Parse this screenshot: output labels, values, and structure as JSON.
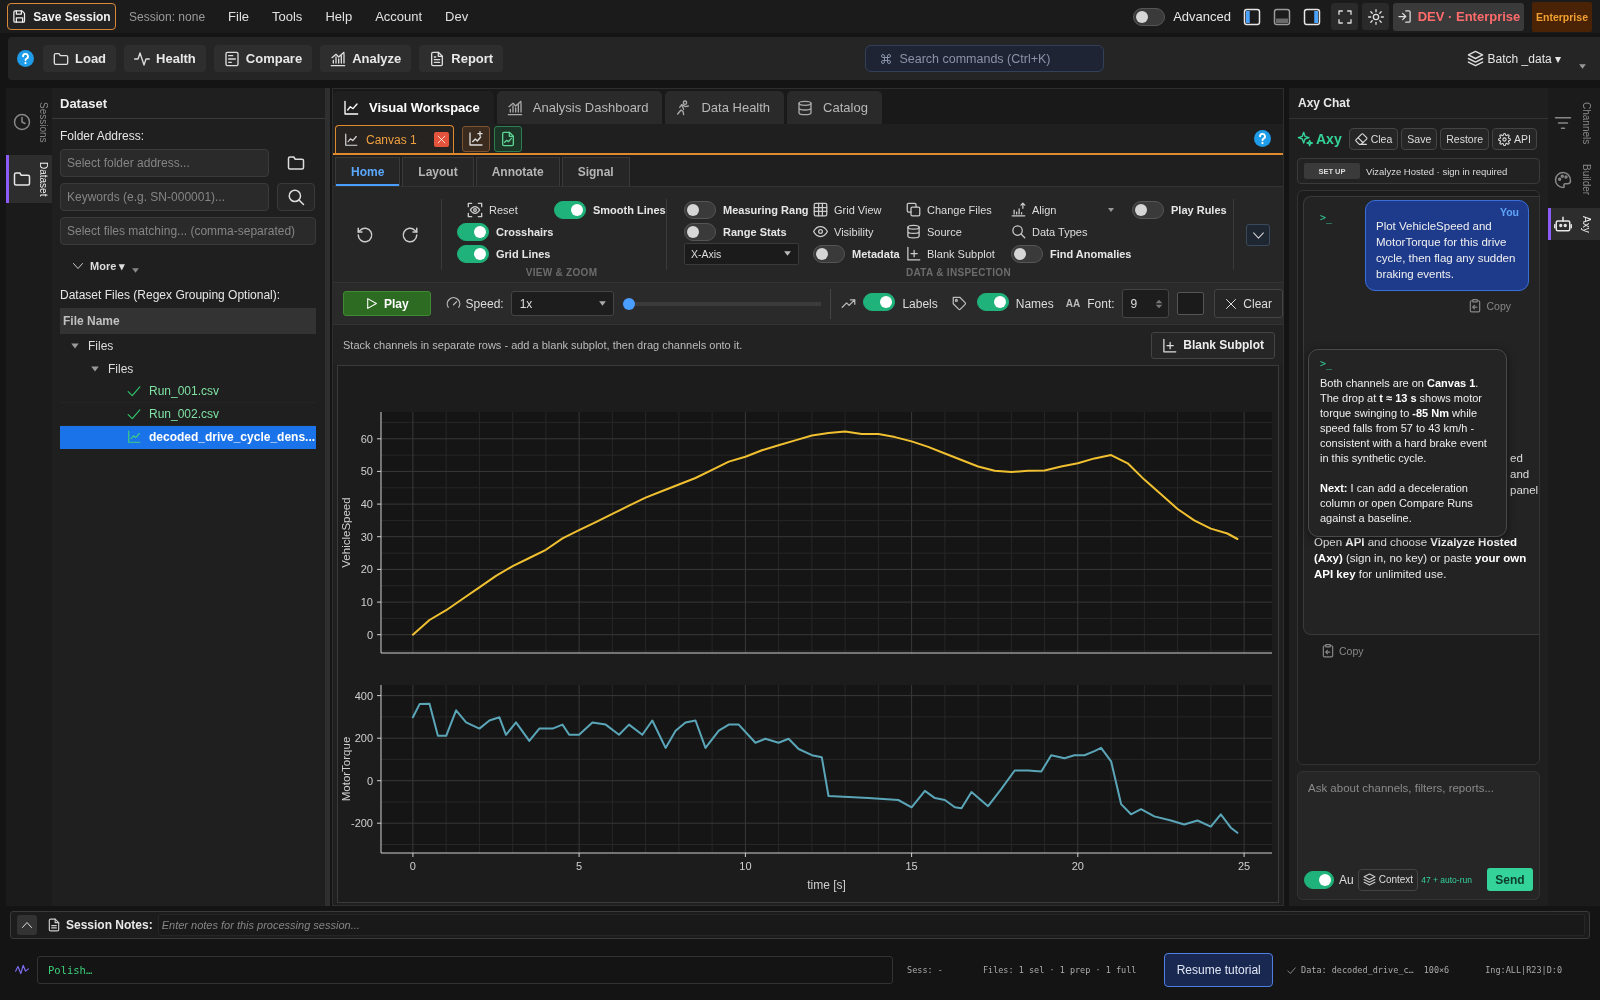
{
  "topbar": {
    "save_button": "Save Session",
    "session": "Session: none",
    "menu": [
      "File",
      "Tools",
      "Help",
      "Account",
      "Dev"
    ],
    "advanced": {
      "label": "Advanced",
      "on": false
    },
    "panel_toggles": [
      {
        "on": true
      },
      {
        "on": false
      },
      {
        "on": true
      }
    ],
    "env_button": "DEV · Enterprise",
    "plan_badge": "Enterprise"
  },
  "toolbar": {
    "buttons": [
      "Load",
      "Health",
      "Compare",
      "Analyze",
      "Report"
    ],
    "search": {
      "placeholder": "Search commands (Ctrl+K)"
    },
    "batch_menu": "Batch _data ▾"
  },
  "left_rail": {
    "tabs": [
      {
        "label": "Sessions",
        "selected": false
      },
      {
        "label": "Dataset",
        "selected": true
      }
    ]
  },
  "dataset": {
    "title": "Dataset",
    "folder_label": "Folder Address:",
    "folder_input": {
      "placeholder": "Select folder address..."
    },
    "keywords_input": {
      "placeholder": "Keywords (e.g. SN-000001)..."
    },
    "match_input": {
      "placeholder": "Select files matching... (comma-separated)"
    },
    "more": "More ▾",
    "files_label": "Dataset Files (Regex Grouping Optional):",
    "column": "File Name",
    "tree": [
      {
        "label": "Files",
        "expanded": true,
        "children": [
          {
            "label": "Files",
            "expanded": true,
            "children": [
              {
                "label": "Run_001.csv",
                "kind": "loaded",
                "selected": false
              },
              {
                "label": "Run_002.csv",
                "kind": "loaded",
                "selected": false
              },
              {
                "label": "decoded_drive_cycle_dens...",
                "kind": "plotted",
                "selected": true
              }
            ]
          }
        ]
      }
    ]
  },
  "workspace": {
    "tabs": [
      {
        "label": "Visual Workspace",
        "selected": true
      },
      {
        "label": "Analysis Dashboard",
        "selected": false
      },
      {
        "label": "Data Health",
        "selected": false
      },
      {
        "label": "Catalog",
        "selected": false
      }
    ],
    "canvas_tabs": [
      {
        "label": "Canvas 1",
        "selected": true
      }
    ],
    "ribbon_tabs": [
      {
        "label": "Home",
        "selected": true
      },
      {
        "label": "Layout",
        "selected": false
      },
      {
        "label": "Annotate",
        "selected": false
      },
      {
        "label": "Signal",
        "selected": false
      }
    ],
    "view_zoom": {
      "title": "VIEW & ZOOM",
      "reset": "Reset",
      "smooth_lines": {
        "label": "Smooth Lines",
        "on": true
      },
      "crosshairs": {
        "label": "Crosshairs",
        "on": true
      },
      "grid_lines": {
        "label": "Grid Lines",
        "on": true
      }
    },
    "data_inspection": {
      "title": "DATA & INSPECTION",
      "columns": [
        [
          {
            "kind": "toggle",
            "label": "Measuring Rang",
            "on": false
          },
          {
            "kind": "toggle",
            "label": "Range Stats",
            "on": false
          },
          {
            "kind": "select",
            "value": "X-Axis"
          }
        ],
        [
          {
            "kind": "action",
            "label": "Grid View"
          },
          {
            "kind": "action",
            "label": "Visibility"
          },
          {
            "kind": "toggle",
            "label": "Metadata",
            "on": false
          }
        ],
        [
          {
            "kind": "action",
            "label": "Change Files"
          },
          {
            "kind": "action",
            "label": "Source"
          },
          {
            "kind": "action",
            "label": "Blank Subplot"
          }
        ],
        [
          {
            "kind": "menu",
            "label": "Align"
          },
          {
            "kind": "action",
            "label": "Data Types"
          },
          {
            "kind": "toggle",
            "label": "Find Anomalies",
            "on": false
          }
        ],
        [
          {
            "kind": "toggle",
            "label": "Play Rules",
            "on": false
          }
        ]
      ]
    },
    "playback": {
      "play": "Play",
      "speed_label": "Speed:",
      "speed": "1x",
      "position": {
        "level": 0
      },
      "labels": {
        "label": "Labels",
        "on": true
      },
      "names": {
        "label": "Names",
        "on": true
      },
      "font_glyph": "AA",
      "font_label": "Font:",
      "font_size": "9",
      "clear": "Clear"
    },
    "hint": "Stack channels in separate rows - add a blank subplot, then drag channels onto it.",
    "blank_subplot": "Blank Subplot",
    "plots": [
      {
        "chart_data": {
          "type": "line",
          "ylabel": "VehicleSpeed",
          "x": [
            0,
            0.5,
            1,
            1.5,
            2,
            2.5,
            3,
            3.5,
            4,
            4.5,
            5,
            5.5,
            6,
            6.5,
            7,
            7.5,
            8,
            8.5,
            9,
            9.5,
            10,
            10.5,
            11,
            11.5,
            12,
            12.5,
            13,
            13.5,
            14,
            14.5,
            15,
            15.5,
            16,
            16.5,
            17,
            17.5,
            18,
            18.5,
            19,
            19.5,
            20,
            20.5,
            21,
            21.5,
            22,
            22.5,
            23,
            23.5,
            24,
            24.5,
            24.8
          ],
          "series": [
            {
              "color": "#f0c030",
              "values": [
                0,
                4.5,
                7.5,
                11,
                14.5,
                18,
                21,
                23.5,
                26,
                29.5,
                32,
                34.5,
                37,
                39.5,
                42,
                44,
                46,
                48,
                50.5,
                53,
                54.5,
                56.5,
                58,
                59.5,
                61,
                61.8,
                62.2,
                61.5,
                61.5,
                60.5,
                59.2,
                57.5,
                55.5,
                53.5,
                51.5,
                50.2,
                49.8,
                50.2,
                50.3,
                51.5,
                52.5,
                54,
                55,
                52.5,
                47.5,
                43,
                38.5,
                35,
                32.5,
                31,
                29.3
              ]
            }
          ],
          "xlim": [
            -0.96,
            25.84
          ],
          "ylim": [
            -5.6,
            68.2
          ],
          "yticks": [
            0,
            10,
            20,
            30,
            40,
            50,
            60
          ],
          "grid": true
        }
      },
      {
        "chart_data": {
          "type": "line",
          "xlabel": "time [s]",
          "ylabel": "MotorTorque",
          "x": [
            0,
            0.2,
            0.5,
            0.75,
            1,
            1.3,
            1.6,
            2,
            2.3,
            2.6,
            2.8,
            3.1,
            3.5,
            3.8,
            4.2,
            4.5,
            4.7,
            5,
            5.4,
            5.8,
            6.2,
            6.5,
            6.9,
            7.2,
            7.6,
            7.9,
            8.2,
            8.5,
            8.8,
            9.2,
            9.5,
            9.8,
            10.3,
            10.6,
            11,
            11.3,
            11.6,
            12,
            12.3,
            12.5,
            13.7,
            14.6,
            15,
            15.4,
            15.7,
            16,
            16.3,
            16.5,
            16.8,
            17.3,
            17.7,
            18.1,
            18.5,
            18.9,
            19.2,
            19.6,
            19.9,
            20.2,
            20.5,
            20.7,
            21,
            21.3,
            21.6,
            21.9,
            22.3,
            22.8,
            23.2,
            23.6,
            24,
            24.3,
            24.6,
            24.8
          ],
          "series": [
            {
              "color": "#5aa6b8",
              "values": [
                298,
                360,
                362,
                211,
                211,
                331,
                274,
                245,
                283,
                298,
                216,
                274,
                187,
                245,
                245,
                264,
                216,
                216,
                274,
                264,
                216,
                264,
                216,
                283,
                154,
                235,
                274,
                283,
                154,
                235,
                264,
                264,
                178,
                197,
                178,
                197,
                149,
                120,
                110,
                -72,
                -82,
                -91,
                -125,
                -48,
                -82,
                -91,
                -125,
                -130,
                -53,
                -120,
                -38,
                48,
                48,
                43,
                120,
                106,
                120,
                120,
                139,
                154,
                91,
                -110,
                -158,
                -134,
                -168,
                -187,
                -206,
                -187,
                -216,
                -158,
                -221,
                -245
              ]
            }
          ],
          "xlim": [
            -0.96,
            25.84
          ],
          "ylim": [
            -340,
            450
          ],
          "xticks": [
            0,
            5,
            10,
            15,
            20,
            25
          ],
          "yticks": [
            -200,
            0,
            200,
            400
          ],
          "grid": true
        }
      }
    ]
  },
  "chat": {
    "title": "Axy Chat",
    "brand": "Axy",
    "actions": [
      "Clea",
      "Save",
      "Restore",
      "API"
    ],
    "setup": {
      "button": "SET UP",
      "status": "Vizalyze Hosted · sign in required"
    },
    "thread": {
      "prompt": ">_",
      "request": {
        "sender": "You",
        "text": "Plot VehicleSpeed and MotorTorque for this drive cycle, then flag any sudden braking events.",
        "copy": "Copy"
      },
      "fragments": [
        "ed",
        "and",
        "panel"
      ],
      "note": "Open **API** and choose **Vizalyze Hosted (Axy)** (sign in, no key) or paste **your own API key** for unlimited use.",
      "copy": "Copy"
    },
    "reply": {
      "prompt": ">_",
      "paragraphs": [
        "Both channels are on **Canvas 1**. The drop at **t ≈ 13 s** shows motor torque swinging to **-85 Nm** while speed falls from 57 to 43 km/h - consistent with a hard brake event in this synthetic cycle.",
        "**Next:** I can add a deceleration column or open Compare Runs against a baseline."
      ]
    },
    "input": {
      "placeholder": "Ask about channels, filters, reports..."
    },
    "auto": {
      "label": "Au",
      "on": true
    },
    "context": "Context",
    "context_note": "47 + auto-run",
    "send": "Send"
  },
  "right_rail": {
    "tabs": [
      {
        "label": "Channels",
        "selected": false
      },
      {
        "label": "Builder",
        "selected": false
      },
      {
        "label": "Axy",
        "selected": true
      }
    ]
  },
  "session_notes": {
    "label": "Session Notes:",
    "placeholder": "Enter notes for this processing session..."
  },
  "status_bar": {
    "command": "Polish…",
    "session": "Sess: -",
    "files": "Files: 1 sel · 1 prep · 1 full",
    "tutorial_button": "Resume tutorial",
    "data": "Data: decoded_drive_c…",
    "shape": "100×6",
    "ingest": "Ing:ALL|R23|D:0"
  }
}
